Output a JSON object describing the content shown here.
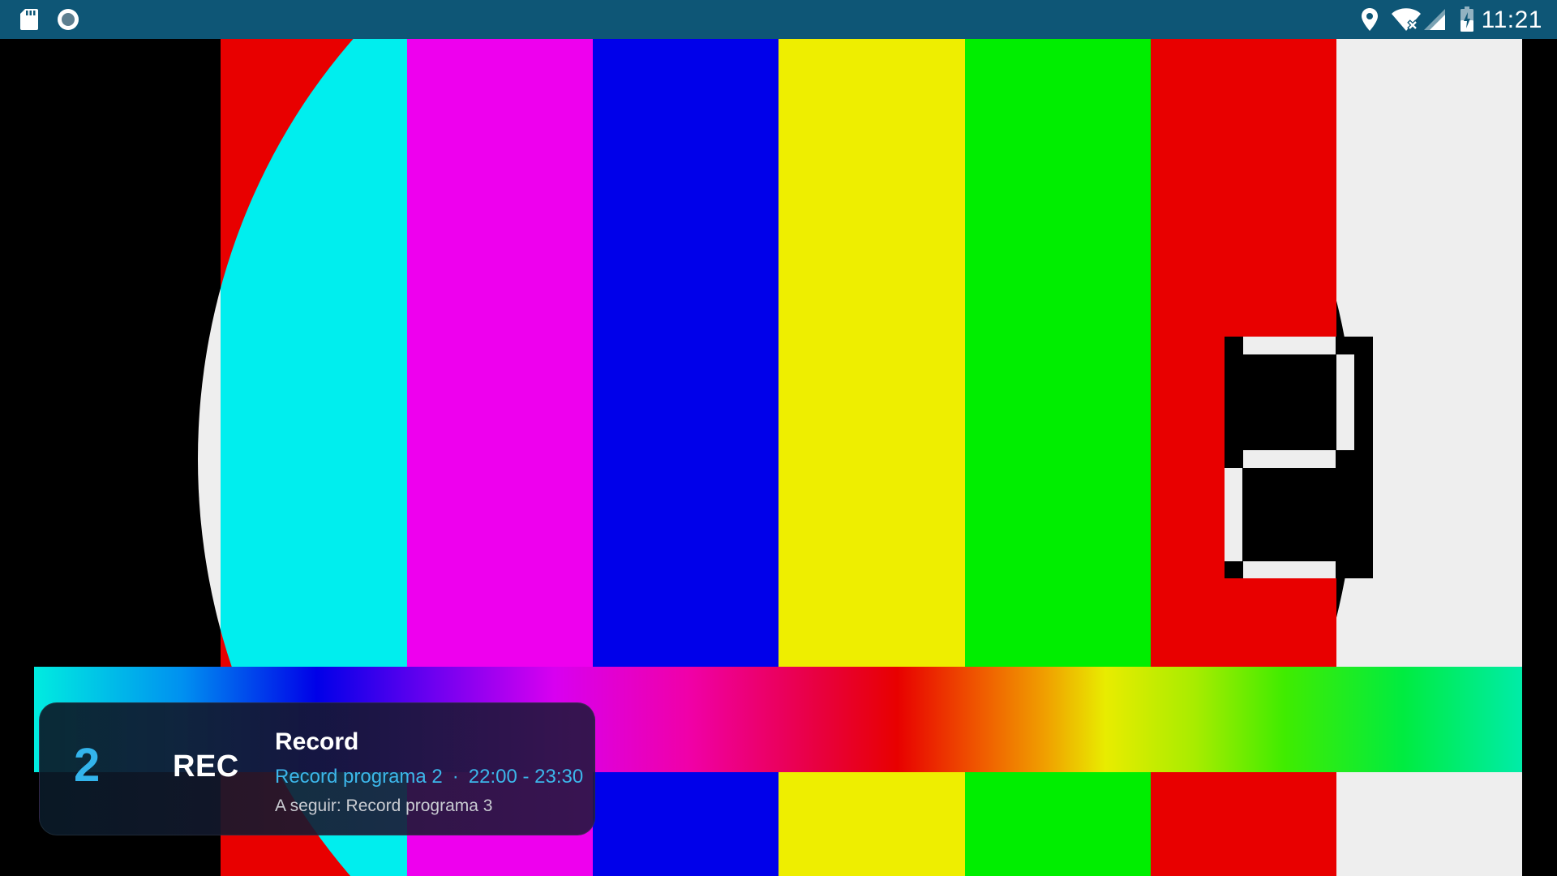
{
  "status_bar": {
    "time": "11:21",
    "left_icons": [
      "sd-card-icon",
      "record-dot-icon"
    ],
    "right_icons": [
      "location-icon",
      "wifi-no-internet-icon",
      "cell-signal-icon",
      "battery-charging-icon"
    ],
    "background_color": "#0e5676"
  },
  "video": {
    "test_pattern": {
      "bars": [
        "#000000",
        "#e80000",
        "#00eeee",
        "#ee00ee",
        "#0000ea",
        "#eeee00",
        "#00ee00",
        "#e80000",
        "#00eeee",
        "#eeeeee",
        "#000000"
      ],
      "channel_digit": "2"
    }
  },
  "channel_overlay": {
    "number": "2",
    "logo_text": "REC",
    "channel_name": "Record",
    "current_program": "Record programa 2",
    "separator": "·",
    "time_range": "22:00 - 23:30",
    "next_label": "A seguir: Record programa 3",
    "accent_color": "#33b4ec"
  }
}
